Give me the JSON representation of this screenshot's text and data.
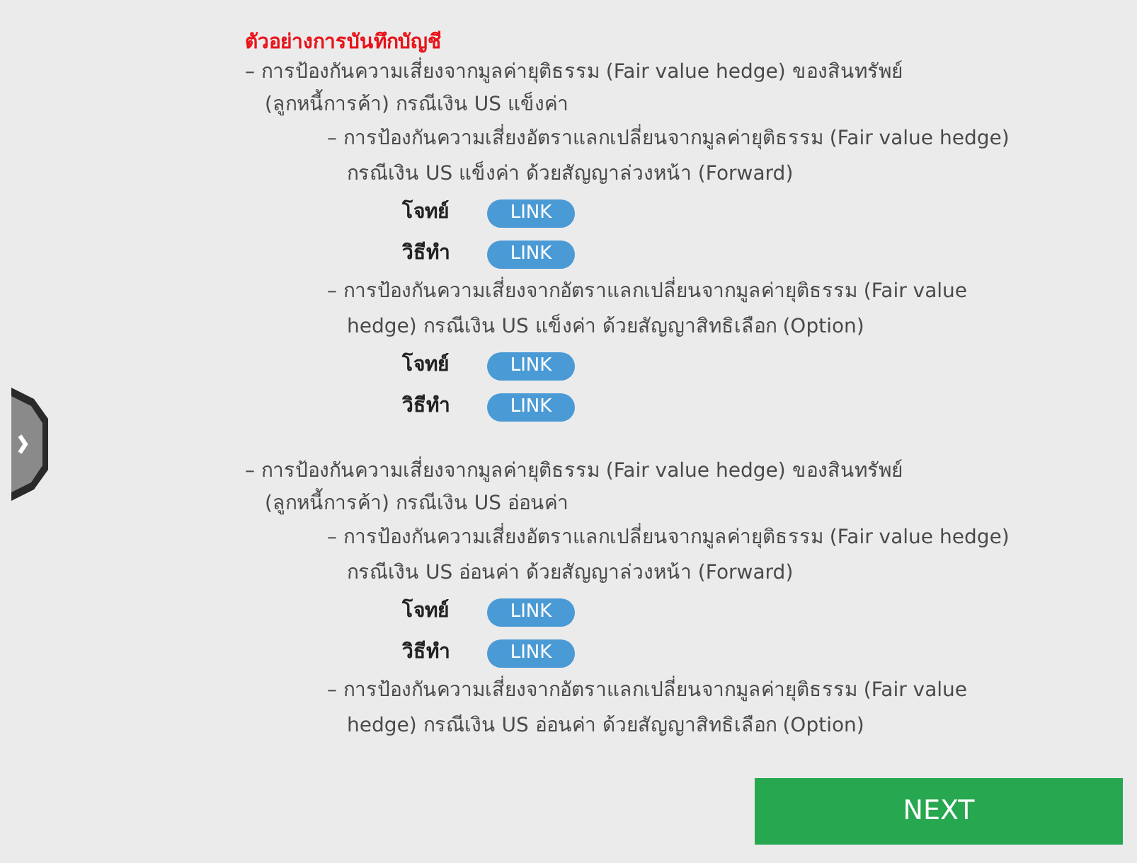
{
  "title": "ตัวอย่างการบันทึกบัญชี",
  "sections": [
    {
      "heading": "– การป้องกันความเสี่ยงจากมูลค่ายุติธรรม (Fair value hedge) ของสินทรัพย์ (ลูกหนี้การค้า) กรณีเงิน US แข็งค่า",
      "items": [
        {
          "text": "– การป้องกันความเสี่ยงอัตราแลกเปลี่ยนจากมูลค่ายุติธรรม (Fair value hedge) กรณีเงิน US แข็งค่า ด้วยสัญญาล่วงหน้า (Forward)",
          "links": [
            {
              "label": "โจทย์",
              "button": "LINK"
            },
            {
              "label": "วิธีทำ",
              "button": "LINK"
            }
          ]
        },
        {
          "text": "– การป้องกันความเสี่ยงจากอัตราแลกเปลี่ยนจากมูลค่ายุติธรรม (Fair value hedge) กรณีเงิน US แข็งค่า ด้วยสัญญาสิทธิเลือก (Option)",
          "links": [
            {
              "label": "โจทย์",
              "button": "LINK"
            },
            {
              "label": "วิธีทำ",
              "button": "LINK"
            }
          ]
        }
      ]
    },
    {
      "heading": "– การป้องกันความเสี่ยงจากมูลค่ายุติธรรม (Fair value hedge) ของสินทรัพย์ (ลูกหนี้การค้า) กรณีเงิน US อ่อนค่า",
      "items": [
        {
          "text": "– การป้องกันความเสี่ยงอัตราแลกเปลี่ยนจากมูลค่ายุติธรรม (Fair value hedge) กรณีเงิน US อ่อนค่า ด้วยสัญญาล่วงหน้า (Forward)",
          "links": [
            {
              "label": "โจทย์",
              "button": "LINK"
            },
            {
              "label": "วิธีทำ",
              "button": "LINK"
            }
          ]
        },
        {
          "text": "– การป้องกันความเสี่ยงจากอัตราแลกเปลี่ยนจากมูลค่ายุติธรรม (Fair value hedge) กรณีเงิน US อ่อนค่า ด้วยสัญญาสิทธิเลือก (Option)"
        }
      ]
    }
  ],
  "next": "NEXT"
}
